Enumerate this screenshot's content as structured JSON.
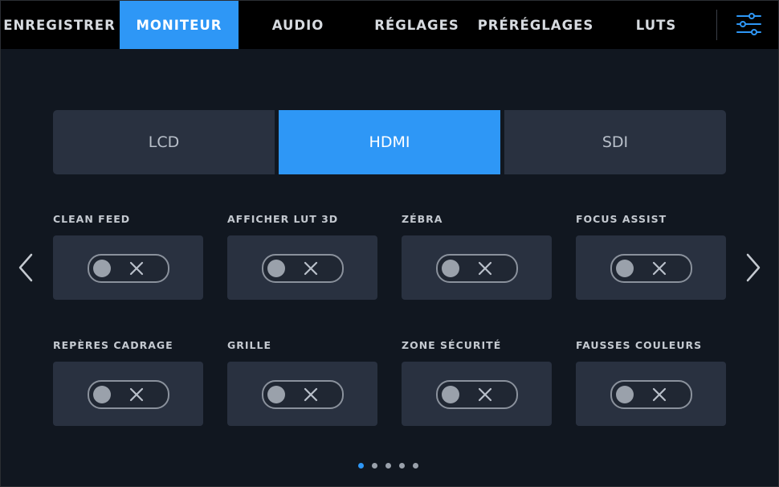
{
  "top_tabs": [
    {
      "label": "ENREGISTRER",
      "active": false
    },
    {
      "label": "MONITEUR",
      "active": true
    },
    {
      "label": "AUDIO",
      "active": false
    },
    {
      "label": "RÉGLAGES",
      "active": false
    },
    {
      "label": "PRÉRÉGLAGES",
      "active": false
    },
    {
      "label": "LUTS",
      "active": false
    }
  ],
  "menu_icon": "sliders-icon",
  "outputs": [
    {
      "label": "LCD",
      "active": false
    },
    {
      "label": "HDMI",
      "active": true
    },
    {
      "label": "SDI",
      "active": false
    }
  ],
  "settings": [
    {
      "label": "CLEAN FEED",
      "enabled": false
    },
    {
      "label": "AFFICHER LUT 3D",
      "enabled": false
    },
    {
      "label": "ZÉBRA",
      "enabled": false
    },
    {
      "label": "FOCUS ASSIST",
      "enabled": false
    },
    {
      "label": "REPÈRES CADRAGE",
      "enabled": false
    },
    {
      "label": "GRILLE",
      "enabled": false
    },
    {
      "label": "ZONE SÉCURITÉ",
      "enabled": false
    },
    {
      "label": "FAUSSES COULEURS",
      "enabled": false
    }
  ],
  "pagination": {
    "pages": 5,
    "current": 1
  },
  "colors": {
    "accent": "#2e97f6",
    "background": "#111720",
    "card": "#293140",
    "topbar": "#000000"
  }
}
